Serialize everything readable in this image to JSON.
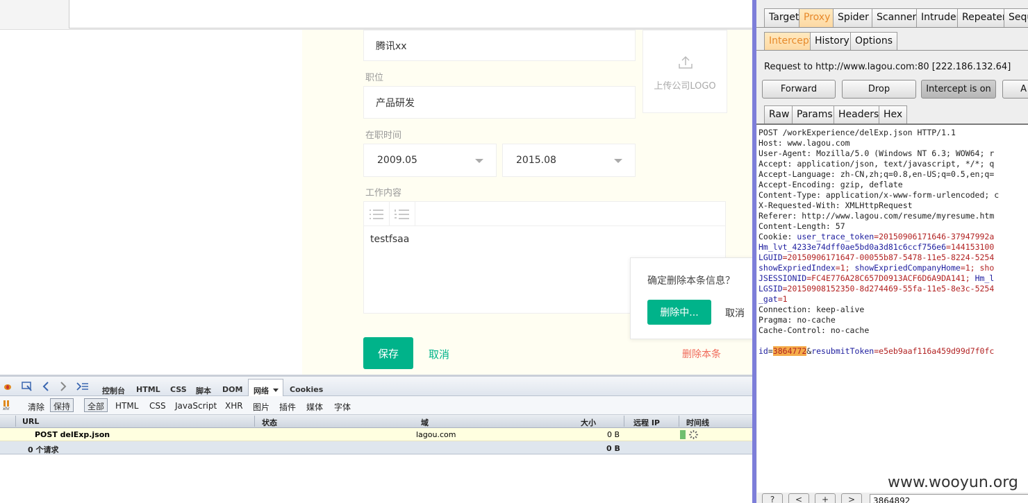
{
  "form": {
    "company_value": "腾讯xx",
    "position_label": "职位",
    "position_value": "产品研发",
    "tenure_label": "在职时间",
    "start_date": "2009.05",
    "end_date": "2015.08",
    "work_content_label": "工作内容",
    "work_content_text": "testfsaa",
    "upload_logo_label": "上传公司LOGO",
    "save_label": "保存",
    "cancel_label": "取消",
    "delete_label": "删除本条",
    "colors": {
      "primary": "#00b38a",
      "danger": "#f06a5a",
      "form_bg": "#fffef2"
    }
  },
  "popover": {
    "question": "确定删除本条信息？",
    "deleting_label": "删除中...",
    "cancel_label": "取消"
  },
  "firebug": {
    "tabs": [
      "控制台",
      "HTML",
      "CSS",
      "脚本",
      "DOM",
      "网络",
      "Cookies"
    ],
    "active_tab": "网络",
    "clear_label": "清除",
    "persist_label": "保持",
    "filters": [
      "全部",
      "HTML",
      "CSS",
      "JavaScript",
      "XHR",
      "图片",
      "插件",
      "媒体",
      "字体"
    ],
    "columns": {
      "url": "URL",
      "status": "状态",
      "domain": "域",
      "size": "大小",
      "remote_ip": "远程 IP",
      "timeline": "时间线"
    },
    "request": {
      "url": "POST delExp.json",
      "domain": "lagou.com",
      "size": "0 B"
    },
    "summary": {
      "count": "0 个请求",
      "size": "0 B"
    }
  },
  "burp": {
    "main_tabs": [
      "Target",
      "Proxy",
      "Spider",
      "Scanner",
      "Intruder",
      "Repeater",
      "Sequ"
    ],
    "active_main": "Proxy",
    "sub_tabs": [
      "Intercept",
      "History",
      "Options"
    ],
    "active_sub": "Intercept",
    "request_line": "Request to http://www.lagou.com:80  [222.186.132.64]",
    "forward_label": "Forward",
    "drop_label": "Drop",
    "intercept_label": "Intercept is on",
    "action_label": "A",
    "view_tabs": [
      "Raw",
      "Params",
      "Headers",
      "Hex"
    ],
    "active_view": "Raw",
    "raw": {
      "l1": "POST /workExperience/delExp.json HTTP/1.1",
      "l2": "Host: www.lagou.com",
      "l3": "User-Agent: Mozilla/5.0 (Windows NT 6.3; WOW64; r",
      "l4": "Accept: application/json, text/javascript, */*; q",
      "l5": "Accept-Language: zh-CN,zh;q=0.8,en-US;q=0.5,en;q=",
      "l6": "Accept-Encoding: gzip, deflate",
      "l7": "Content-Type: application/x-www-form-urlencoded; c",
      "l8": "X-Requested-With: XMLHttpRequest",
      "l9": "Referer: http://www.lagou.com/resume/myresume.htm",
      "l10": "Content-Length: 57",
      "cookie_label": "Cookie: ",
      "c1k": "user_trace_token",
      "c1v": "=20150906171646-37947992a",
      "c2k": "Hm_lvt_4233e74dff0ae5bd0a3d81c6ccf756e6",
      "c2v": "=144153100",
      "c3k": "LGUID",
      "c3v": "=20150906171647-00055b87-5478-11e5-8224-5254",
      "c4k": "showExpriedIndex",
      "c4v": "=1; ",
      "c4k2": "showExpriedCompanyHome",
      "c4v2": "=1; sho",
      "c5k": "JSESSIONID",
      "c5v": "=FC4E776A28C657D0913ACF6D6A9DA141; ",
      "c5k2": "Hm_l",
      "c6k": "LGSID",
      "c6v": "=20150908152350-8d274469-55fa-11e5-8e3c-5254",
      "c7k": "_gat",
      "c7v": "=1",
      "l11": "Connection: keep-alive",
      "l12": "Pragma: no-cache",
      "l13": "Cache-Control: no-cache",
      "b_k": "id",
      "b_eq": "=",
      "b_id": "3864772",
      "b_amp": "&",
      "b_k2": "resubmitToken",
      "b_v2": "=e5eb9aaf116a459d99d7f0fc"
    },
    "watermark": "www.wooyun.org",
    "bottom_buttons": [
      "?",
      "<",
      "+",
      ">"
    ],
    "search_value": "3864892"
  }
}
